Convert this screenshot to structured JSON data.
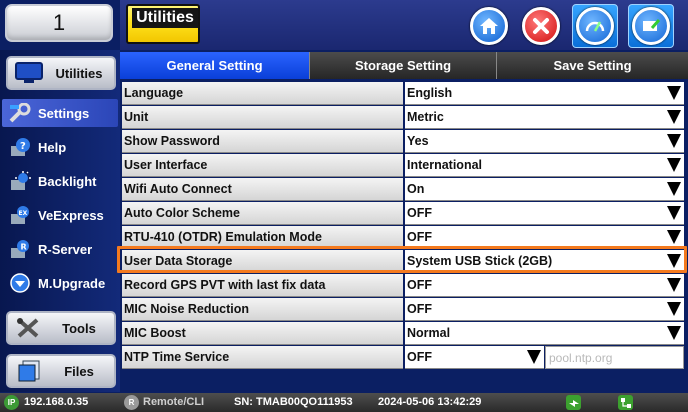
{
  "tab_indicator": "1",
  "header": {
    "title": "Utilities",
    "buttons": [
      {
        "name": "home-button",
        "icon": "home-icon"
      },
      {
        "name": "close-button",
        "icon": "close-icon"
      },
      {
        "name": "performance-button",
        "icon": "gauge-icon"
      },
      {
        "name": "screenshot-button",
        "icon": "screenshot-icon"
      }
    ]
  },
  "sidebar": {
    "top_button": "Utilities",
    "items": [
      {
        "label": "Settings",
        "icon": "settings-icon",
        "active": true
      },
      {
        "label": "Help",
        "icon": "help-icon"
      },
      {
        "label": "Backlight",
        "icon": "backlight-icon"
      },
      {
        "label": "VeExpress",
        "icon": "veexpress-icon"
      },
      {
        "label": "R-Server",
        "icon": "r-server-icon"
      },
      {
        "label": "M.Upgrade",
        "icon": "upgrade-icon"
      }
    ],
    "tools_button": "Tools",
    "files_button": "Files"
  },
  "tabs": [
    {
      "label": "General Setting",
      "active": true
    },
    {
      "label": "Storage Setting"
    },
    {
      "label": "Save Setting"
    }
  ],
  "settings": [
    {
      "name": "Language",
      "value": "English"
    },
    {
      "name": "Unit",
      "value": "Metric"
    },
    {
      "name": "Show Password",
      "value": "Yes"
    },
    {
      "name": "User Interface",
      "value": "International"
    },
    {
      "name": "Wifi Auto Connect",
      "value": "On"
    },
    {
      "name": "Auto Color Scheme",
      "value": "OFF"
    },
    {
      "name": "RTU-410 (OTDR) Emulation Mode",
      "value": "OFF"
    },
    {
      "name": "User Data Storage",
      "value": "System USB Stick (2GB)",
      "highlighted": true
    },
    {
      "name": "Record GPS PVT with last fix data",
      "value": "OFF"
    },
    {
      "name": "MIC Noise Reduction",
      "value": "OFF"
    },
    {
      "name": "MIC Boost",
      "value": "Normal"
    },
    {
      "name": "NTP Time Service",
      "value": "OFF",
      "extra_placeholder": "pool.ntp.org"
    }
  ],
  "status": {
    "ip_badge": "IP",
    "ip": "192.168.0.35",
    "remote_badge": "R",
    "remote": "Remote/CLI",
    "serial": "SN: TMAB00QO111953",
    "datetime": "2024-05-06  13:42:29"
  },
  "colors": {
    "background": "#0b1f63",
    "active_tab": "#1448f0",
    "highlight": "#f47a1f",
    "title_yellow": "#ffe31d"
  }
}
